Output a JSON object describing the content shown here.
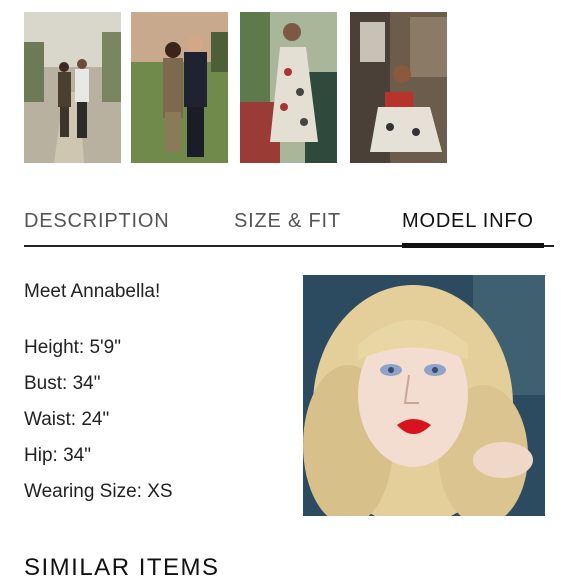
{
  "tabs": [
    {
      "label": "DESCRIPTION",
      "active": false
    },
    {
      "label": "SIZE & FIT",
      "active": false
    },
    {
      "label": "MODEL INFO",
      "active": true
    }
  ],
  "model_info": {
    "intro": "Meet Annabella!",
    "height_label": "Height:",
    "height_value": "5'9\"",
    "bust_label": "Bust:",
    "bust_value": "34\"",
    "waist_label": "Waist:",
    "waist_value": "24\"",
    "hip_label": "Hip:",
    "hip_value": "34\"",
    "size_label": "Wearing Size:",
    "size_value": "XS"
  },
  "similar_items": {
    "heading": "SIMILAR ITEMS"
  },
  "colors": {
    "active_tab": "#111111",
    "inactive_tab": "#555555",
    "underline": "#222222"
  }
}
